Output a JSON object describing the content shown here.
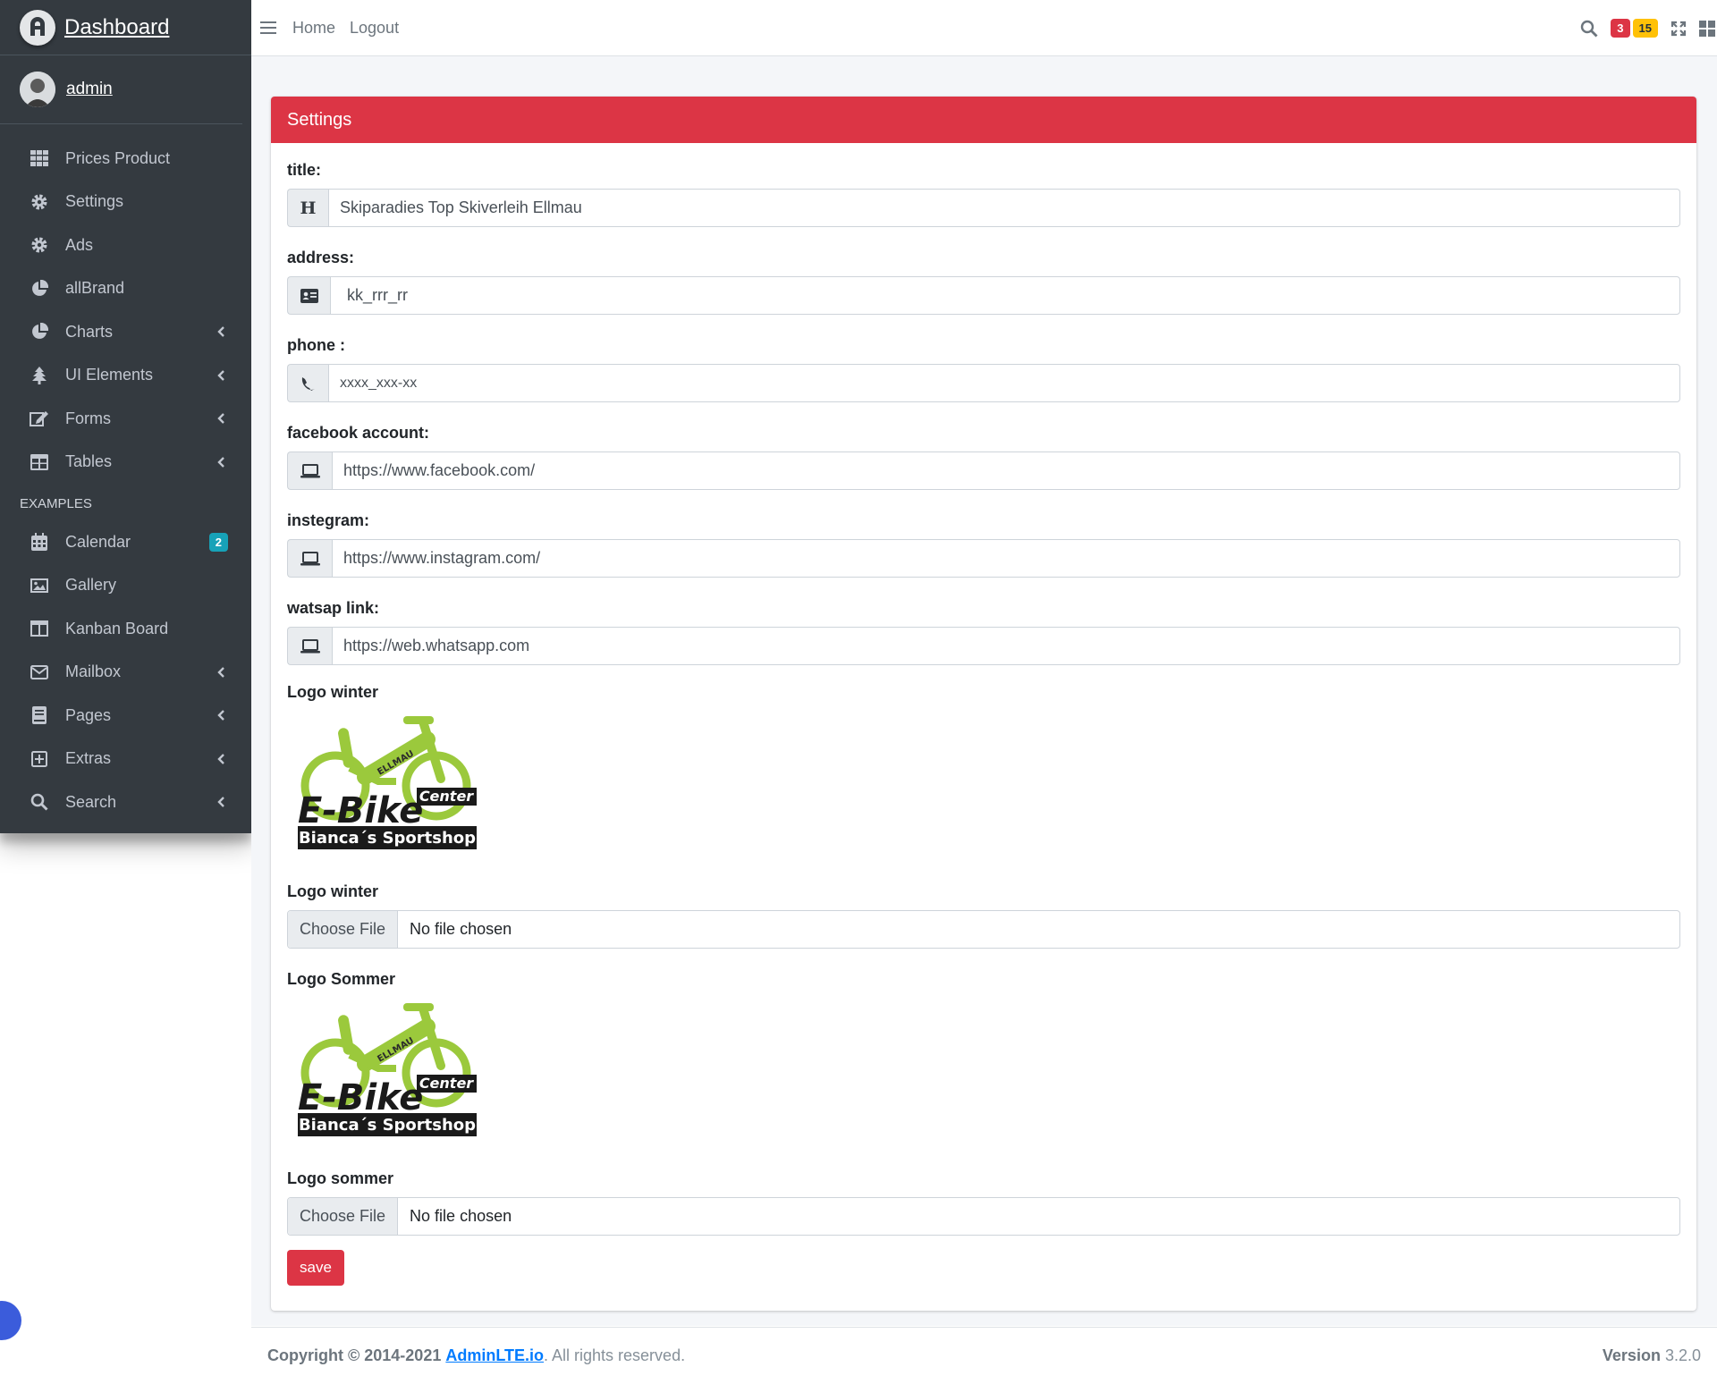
{
  "brand": {
    "title": "Dashboard"
  },
  "user": {
    "name": "admin"
  },
  "sidebar": {
    "items": [
      {
        "label": "Prices Product",
        "icon": "grid-icon"
      },
      {
        "label": "Settings",
        "icon": "gear-icon"
      },
      {
        "label": "Ads",
        "icon": "gear-icon"
      },
      {
        "label": "allBrand",
        "icon": "pie-chart-icon"
      },
      {
        "label": "Charts",
        "icon": "pie-chart-icon",
        "chevron": true
      },
      {
        "label": "UI Elements",
        "icon": "tree-icon",
        "chevron": true
      },
      {
        "label": "Forms",
        "icon": "edit-icon",
        "chevron": true
      },
      {
        "label": "Tables",
        "icon": "table-icon",
        "chevron": true
      }
    ],
    "header": "EXAMPLES",
    "examples": [
      {
        "label": "Calendar",
        "icon": "calendar-icon",
        "badge": "2"
      },
      {
        "label": "Gallery",
        "icon": "image-icon"
      },
      {
        "label": "Kanban Board",
        "icon": "columns-icon"
      },
      {
        "label": "Mailbox",
        "icon": "envelope-icon",
        "chevron": true
      },
      {
        "label": "Pages",
        "icon": "book-icon",
        "chevron": true
      },
      {
        "label": "Extras",
        "icon": "plus-square-icon",
        "chevron": true
      },
      {
        "label": "Search",
        "icon": "search-icon",
        "chevron": true
      }
    ]
  },
  "topbar": {
    "home": "Home",
    "logout": "Logout",
    "messages_count": "3",
    "notifications_count": "15"
  },
  "card": {
    "title": "Settings",
    "fields": {
      "title_label": "title:",
      "title_value": "Skiparadies Top Skiverleih Ellmau",
      "address_label": "address:",
      "address_value": "kk_rrr_rr",
      "phone_label": "phone :",
      "phone_value": "xxxx_xxx-xx",
      "facebook_label": "facebook account:",
      "facebook_value": "https://www.facebook.com/",
      "instagram_label": "instegram:",
      "instagram_value": "https://www.instagram.com/",
      "whatsapp_label": "watsap link:",
      "whatsapp_value": "https://web.whatsapp.com"
    },
    "logo_winter_heading": "Logo winter",
    "logo_winter_label": "Logo winter",
    "logo_sommer_heading": "Logo Sommer",
    "logo_sommer_label": "Logo sommer",
    "logo_text": {
      "brand": "E-Bike",
      "tag": "Center",
      "shop": "Bianca´s Sportshop",
      "frame": "ELLMAU"
    },
    "file_button": "Choose File",
    "file_none": "No file chosen",
    "save": "save"
  },
  "footer": {
    "copyright": "Copyright © 2014-2021",
    "link": "AdminLTE.io",
    "rights": ". All rights reserved.",
    "version_label": "Version",
    "version": "3.2.0"
  },
  "colors": {
    "danger": "#dc3545",
    "sidebar": "#343a40",
    "info": "#17a2b8",
    "warning": "#ffc107",
    "logo_green": "#9bc93c"
  }
}
